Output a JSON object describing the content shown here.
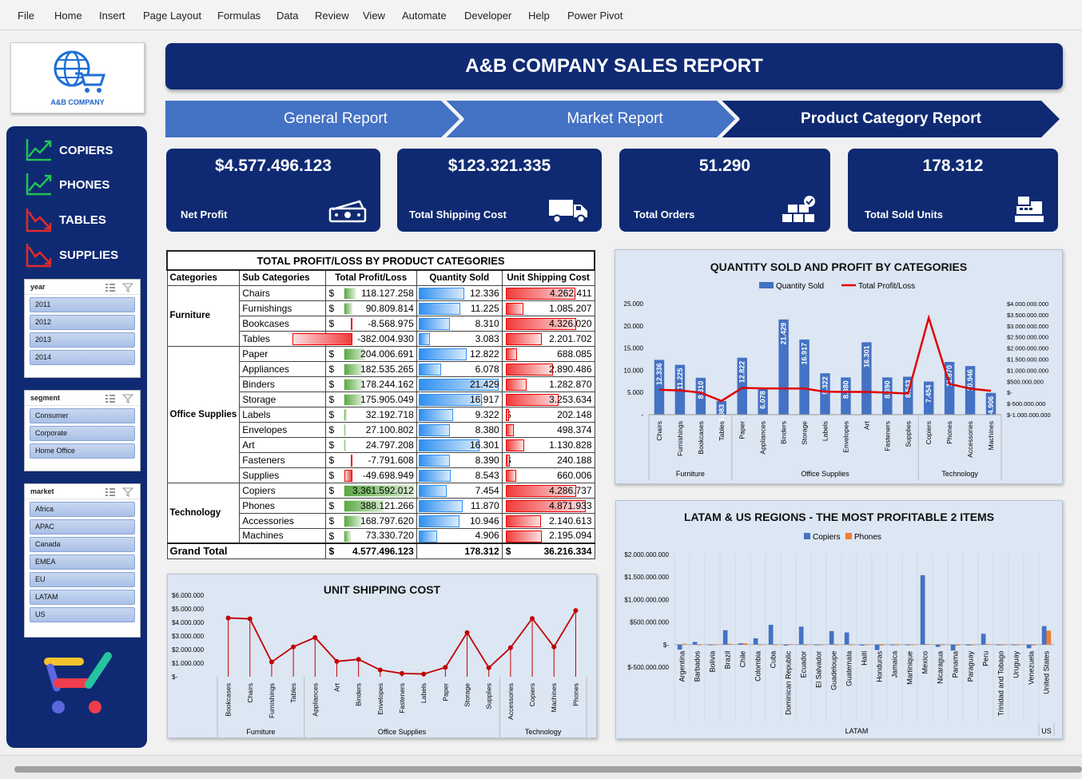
{
  "menu": [
    "File",
    "Home",
    "Insert",
    "Page Layout",
    "Formulas",
    "Data",
    "Review",
    "View",
    "Automate",
    "Developer",
    "Help",
    "Power Pivot"
  ],
  "logo_text": "A&B COMPANY",
  "title": "A&B COMPANY SALES REPORT",
  "tabs": [
    "General Report",
    "Market Report",
    "Product Category Report"
  ],
  "nav": [
    {
      "label": "COPIERS",
      "trend": "up"
    },
    {
      "label": "PHONES",
      "trend": "up"
    },
    {
      "label": "TABLES",
      "trend": "down"
    },
    {
      "label": "SUPPLIES",
      "trend": "down"
    }
  ],
  "slicers": {
    "year": {
      "title": "year",
      "items": [
        "2011",
        "2012",
        "2013",
        "2014"
      ]
    },
    "segment": {
      "title": "segment",
      "items": [
        "Consumer",
        "Corporate",
        "Home Office"
      ]
    },
    "market": {
      "title": "market",
      "items": [
        "Africa",
        "APAC",
        "Canada",
        "EMEA",
        "EU",
        "LATAM",
        "US"
      ]
    }
  },
  "kpis": [
    {
      "value": "$4.577.496.123",
      "label": "Net Profit",
      "icon": "money-icon"
    },
    {
      "value": "$123.321.335",
      "label": "Total Shipping Cost",
      "icon": "truck-icon"
    },
    {
      "value": "51.290",
      "label": "Total Orders",
      "icon": "boxes-icon"
    },
    {
      "value": "178.312",
      "label": "Total Sold Units",
      "icon": "cash-register-icon"
    }
  ],
  "table": {
    "title": "TOTAL PROFIT/LOSS BY PRODUCT CATEGORIES",
    "headers": [
      "Categories",
      "Sub Categories",
      "Total Profit/Loss",
      "Quantity Sold",
      "Unit Shipping Cost"
    ],
    "groups": [
      {
        "category": "Furniture",
        "rows": [
          {
            "sub": "Chairs",
            "profit": "118.127.258",
            "qty": "12.336",
            "ship": "4.262.411"
          },
          {
            "sub": "Furnishings",
            "profit": "90.809.814",
            "qty": "11.225",
            "ship": "1.085.207"
          },
          {
            "sub": "Bookcases",
            "profit": "-8.568.975",
            "qty": "8.310",
            "ship": "4.326.020"
          },
          {
            "sub": "Tables",
            "profit": "-382.004.930",
            "qty": "3.083",
            "ship": "2.201.702"
          }
        ]
      },
      {
        "category": "Office Supplies",
        "rows": [
          {
            "sub": "Paper",
            "profit": "204.006.691",
            "qty": "12.822",
            "ship": "688.085"
          },
          {
            "sub": "Appliances",
            "profit": "182.535.265",
            "qty": "6.078",
            "ship": "2.890.486"
          },
          {
            "sub": "Binders",
            "profit": "178.244.162",
            "qty": "21.429",
            "ship": "1.282.870"
          },
          {
            "sub": "Storage",
            "profit": "175.905.049",
            "qty": "16.917",
            "ship": "3.253.634"
          },
          {
            "sub": "Labels",
            "profit": "32.192.718",
            "qty": "9.322",
            "ship": "202.148"
          },
          {
            "sub": "Envelopes",
            "profit": "27.100.802",
            "qty": "8.380",
            "ship": "498.374"
          },
          {
            "sub": "Art",
            "profit": "24.797.208",
            "qty": "16.301",
            "ship": "1.130.828"
          },
          {
            "sub": "Fasteners",
            "profit": "-7.791.608",
            "qty": "8.390",
            "ship": "240.188"
          },
          {
            "sub": "Supplies",
            "profit": "-49.698.949",
            "qty": "8.543",
            "ship": "660.006"
          }
        ]
      },
      {
        "category": "Technology",
        "rows": [
          {
            "sub": "Copiers",
            "profit": "3.361.592.012",
            "qty": "7.454",
            "ship": "4.286.737"
          },
          {
            "sub": "Phones",
            "profit": "388.121.266",
            "qty": "11.870",
            "ship": "4.871.933"
          },
          {
            "sub": "Accessories",
            "profit": "168.797.620",
            "qty": "10.946",
            "ship": "2.140.613"
          },
          {
            "sub": "Machines",
            "profit": "73.330.720",
            "qty": "4.906",
            "ship": "2.195.094"
          }
        ]
      }
    ],
    "grand_total": {
      "label": "Grand Total",
      "profit": "4.577.496.123",
      "qty": "178.312",
      "ship": "36.216.334"
    },
    "currency": "$"
  },
  "chart_data": [
    {
      "type": "bar",
      "title": "QUANTITY SOLD AND PROFIT BY CATEGORIES",
      "categories": [
        "Chairs",
        "Furnishings",
        "Bookcases",
        "Tables",
        "Paper",
        "Appliances",
        "Binders",
        "Storage",
        "Labels",
        "Envelopes",
        "Art",
        "Fasteners",
        "Supplies",
        "Copiers",
        "Phones",
        "Accessories",
        "Machines"
      ],
      "groups": [
        {
          "name": "Furniture",
          "count": 4
        },
        {
          "name": "Office Supplies",
          "count": 9
        },
        {
          "name": "Technology",
          "count": 4
        }
      ],
      "series": [
        {
          "name": "Quantity Sold",
          "type": "bar",
          "color": "#4472c4",
          "values": [
            12336,
            11225,
            8310,
            3083,
            12822,
            6078,
            21429,
            16917,
            9322,
            8380,
            16301,
            8390,
            8543,
            7454,
            11870,
            10946,
            4906
          ],
          "labels": [
            "12.336",
            "11.225",
            "8.310",
            "3.083",
            "12.822",
            "6.078",
            "21.429",
            "16.917",
            "9.322",
            "8.380",
            "16.301",
            "8.390",
            "8.543",
            "7.454",
            "11.870",
            "10.946",
            "4.906"
          ]
        },
        {
          "name": "Total Profit/Loss",
          "type": "line",
          "axis": "secondary",
          "color": "#e00000",
          "values": [
            118127258,
            90809814,
            -8568975,
            -382004930,
            204006691,
            182535265,
            178244162,
            175905049,
            32192718,
            27100802,
            24797208,
            -7791608,
            -49698949,
            3361592012,
            388121266,
            168797620,
            73330720
          ]
        }
      ],
      "y_ticks": [
        "25.000",
        "20.000",
        "15.000",
        "10.000",
        "5.000",
        "-"
      ],
      "ylim": [
        0,
        25000
      ],
      "y2_ticks": [
        "$4.000.000.000",
        "$3.500.000.000",
        "$3.000.000.000",
        "$2.500.000.000",
        "$2.000.000.000",
        "$1.500.000.000",
        "$1.000.000.000",
        "$500.000.000",
        "$-",
        "$-500.000.000",
        "$-1.000.000.000"
      ],
      "y2lim": [
        -1000000000,
        4000000000
      ],
      "legend": "top"
    },
    {
      "type": "line",
      "title": "UNIT SHIPPING COST",
      "categories": [
        "Bookcases",
        "Chairs",
        "Furnishings",
        "Tables",
        "Appliances",
        "Art",
        "Binders",
        "Envelopes",
        "Fasteners",
        "Labels",
        "Paper",
        "Storage",
        "Supplies",
        "Accessories",
        "Copiers",
        "Machines",
        "Phones"
      ],
      "groups": [
        {
          "name": "Furniture",
          "count": 4
        },
        {
          "name": "Office Supplies",
          "count": 9
        },
        {
          "name": "Technology",
          "count": 4
        }
      ],
      "series": [
        {
          "name": "Unit Shipping Cost",
          "color": "#c00000",
          "values": [
            4326020,
            4262411,
            1085207,
            2201702,
            2890486,
            1130828,
            1282870,
            498374,
            240188,
            202148,
            688085,
            3253634,
            660006,
            2140613,
            4286737,
            2195094,
            4871933
          ]
        }
      ],
      "y_ticks": [
        "$6.000.000",
        "$5.000.000",
        "$4.000.000",
        "$3.000.000",
        "$2.000.000",
        "$1.000.000",
        "$-"
      ],
      "ylim": [
        0,
        6000000
      ]
    },
    {
      "type": "bar",
      "title": "LATAM & US REGIONS - THE MOST PROFITABLE 2 ITEMS",
      "categories": [
        "Argentina",
        "Barbados",
        "Bolivia",
        "Brazil",
        "Chile",
        "Colombia",
        "Cuba",
        "Dominican Republic",
        "Ecuador",
        "El Salvador",
        "Guadeloupe",
        "Guatemala",
        "Haiti",
        "Honduras",
        "Jamaica",
        "Martinique",
        "Mexico",
        "Nicaragua",
        "Panama",
        "Paraguay",
        "Peru",
        "Trinidad and Tobago",
        "Uruguay",
        "Venezuela",
        "United States"
      ],
      "groups": [
        {
          "name": "LATAM",
          "count": 24
        },
        {
          "name": "US",
          "count": 1
        }
      ],
      "series": [
        {
          "name": "Copiers",
          "color": "#4472c4",
          "values": [
            -110000000,
            60000000,
            0,
            320000000,
            30000000,
            140000000,
            440000000,
            -20000000,
            400000000,
            0,
            300000000,
            270000000,
            -20000000,
            -120000000,
            0,
            0,
            1540000000,
            -50000000,
            -130000000,
            -20000000,
            240000000,
            0,
            0,
            -80000000,
            410000000
          ]
        },
        {
          "name": "Phones",
          "color": "#ed7d31",
          "values": [
            20000000,
            0,
            0,
            20000000,
            30000000,
            0,
            0,
            10000000,
            0,
            0,
            0,
            0,
            0,
            -20000000,
            0,
            0,
            10000000,
            0,
            -20000000,
            0,
            10000000,
            0,
            0,
            -20000000,
            310000000
          ]
        }
      ],
      "y_ticks": [
        "$2.000.000.000",
        "$1.500.000.000",
        "$1.000.000.000",
        "$500.000.000",
        "$-",
        "$-500.000.000"
      ],
      "ylim": [
        -500000000,
        2000000000
      ],
      "legend": "top"
    }
  ]
}
